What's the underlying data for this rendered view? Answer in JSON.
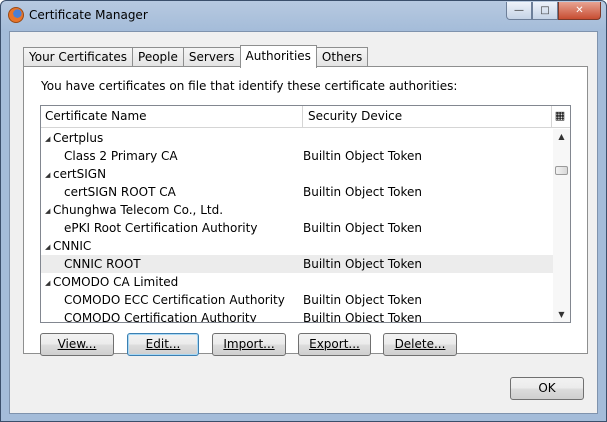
{
  "window": {
    "title": "Certificate Manager"
  },
  "tabs": [
    {
      "label": "Your Certificates",
      "active": false
    },
    {
      "label": "People",
      "active": false
    },
    {
      "label": "Servers",
      "active": false
    },
    {
      "label": "Authorities",
      "active": true
    },
    {
      "label": "Others",
      "active": false
    }
  ],
  "panel": {
    "intro": "You have certificates on file that identify these certificate authorities:",
    "columns": {
      "name": "Certificate Name",
      "device": "Security Device"
    },
    "rows": [
      {
        "type": "group",
        "name": "Certplus",
        "device": ""
      },
      {
        "type": "child",
        "name": "Class 2 Primary CA",
        "device": "Builtin Object Token"
      },
      {
        "type": "group",
        "name": "certSIGN",
        "device": ""
      },
      {
        "type": "child",
        "name": "certSIGN ROOT CA",
        "device": "Builtin Object Token"
      },
      {
        "type": "group",
        "name": "Chunghwa Telecom Co., Ltd.",
        "device": ""
      },
      {
        "type": "child",
        "name": "ePKI Root Certification Authority",
        "device": "Builtin Object Token"
      },
      {
        "type": "group",
        "name": "CNNIC",
        "device": ""
      },
      {
        "type": "child",
        "name": "CNNIC ROOT",
        "device": "Builtin Object Token",
        "selected": true
      },
      {
        "type": "group",
        "name": "COMODO CA Limited",
        "device": ""
      },
      {
        "type": "child",
        "name": "COMODO ECC Certification Authority",
        "device": "Builtin Object Token"
      },
      {
        "type": "child",
        "name": "COMODO Certification Authority",
        "device": "Builtin Object Token"
      }
    ],
    "buttons": {
      "view": "View...",
      "edit": "Edit...",
      "import": "Import...",
      "export": "Export...",
      "delete": "Delete..."
    }
  },
  "footer": {
    "ok": "OK"
  },
  "icons": {
    "app": "firefox-icon",
    "minimize": "minimize-icon",
    "maximize": "maximize-icon",
    "close": "close-icon",
    "column_picker": "column-picker-icon",
    "twisty": "expanded-triangle-icon",
    "scroll_up": "scroll-up-arrow-icon",
    "scroll_down": "scroll-down-arrow-icon"
  }
}
